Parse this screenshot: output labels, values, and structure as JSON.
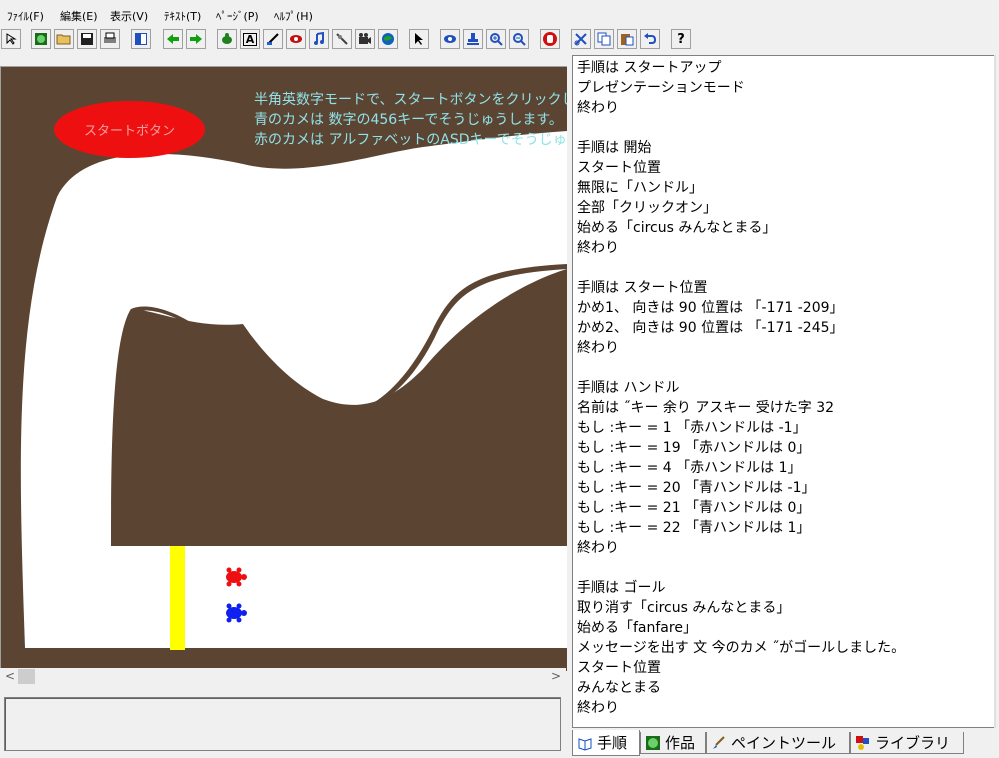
{
  "menu": [
    {
      "id": "file",
      "label": "ﾌｧｲﾙ(F)"
    },
    {
      "id": "edit",
      "label": "編集(E)"
    },
    {
      "id": "view",
      "label": "表示(V)"
    },
    {
      "id": "text",
      "label": "ﾃｷｽﾄ(T)"
    },
    {
      "id": "page",
      "label": "ﾍﾟｰｼﾞ(P)"
    },
    {
      "id": "help",
      "label": "ﾍﾙﾌﾟ(H)"
    }
  ],
  "toolbar": {
    "help_label": "?",
    "text_tool_label": "A"
  },
  "stage": {
    "instructions": [
      "半角英数字モードで、スタートボタンをクリックし",
      "青のカメは 数字の456キーでそうじゅうします。",
      "赤のカメは アルファベットのASDキーでそうじゅ"
    ],
    "start_button_label": "スタートボタン",
    "colors": {
      "background": "#5c4433",
      "track": "#ffffff",
      "goal_line": "#ffff00",
      "red_turtle": "#ee1010",
      "blue_turtle": "#1020ee"
    }
  },
  "message_box": "",
  "code_lines": [
    "手順は スタートアップ",
    "プレゼンテーションモード",
    "終わり",
    "",
    "手順は 開始",
    "スタート位置",
    "無限に「ハンドル」",
    "全部「クリックオン」",
    "始める「circus みんなとまる」",
    "終わり",
    "",
    "手順は スタート位置",
    "かめ1、 向きは 90 位置は 「-171 -209」",
    "かめ2、 向きは 90 位置は 「-171 -245」",
    "終わり",
    "",
    "手順は ハンドル",
    "名前は ˝キー 余り アスキー 受けた字 32",
    "もし :キー = 1 「赤ハンドルは -1」",
    "もし :キー = 19 「赤ハンドルは 0」",
    "もし :キー = 4 「赤ハンドルは 1」",
    "もし :キー = 20 「青ハンドルは -1」",
    "もし :キー = 21 「青ハンドルは 0」",
    "もし :キー = 22 「青ハンドルは 1」",
    "終わり",
    "",
    "手順は ゴール",
    "取り消す「circus みんなとまる」",
    "始める「fanfare」",
    "メッセージを出す 文 今のカメ ˝がゴールしました。",
    "スタート位置",
    "みんなとまる",
    "終わり"
  ],
  "tabs": [
    {
      "id": "procedure",
      "label": "手順",
      "active": true
    },
    {
      "id": "works",
      "label": "作品",
      "active": false
    },
    {
      "id": "paint",
      "label": "ペイントツール",
      "active": false
    },
    {
      "id": "library",
      "label": "ライブラリ",
      "active": false
    }
  ]
}
